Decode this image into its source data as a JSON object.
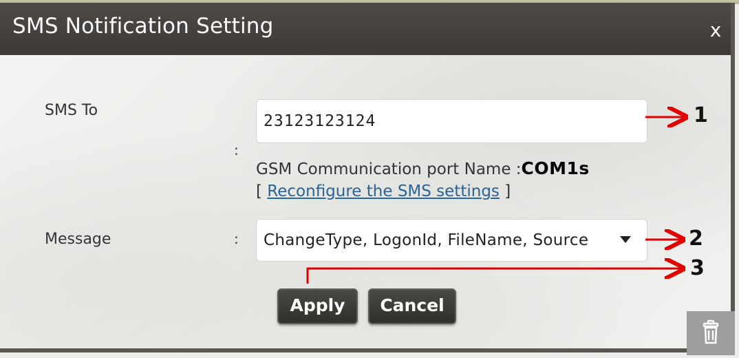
{
  "dialog": {
    "title": "SMS Notification Setting",
    "close_label": "x"
  },
  "form": {
    "sms_to": {
      "label": "SMS To",
      "separator": ":",
      "value": "23123123124"
    },
    "gsm": {
      "prefix": "GSM Communication port Name :",
      "port_name": "COM1s"
    },
    "reconfigure": {
      "open_bracket": "[ ",
      "link_text": "Reconfigure the SMS settings",
      "close_bracket": " ]"
    },
    "message": {
      "label": "Message",
      "separator": ":",
      "selected_value": "ChangeType, LogonId, FileName, Source"
    }
  },
  "buttons": {
    "apply_label": "Apply",
    "cancel_label": "Cancel"
  },
  "footer": {
    "trash_icon": "trash-icon"
  },
  "annotations": {
    "callouts": [
      "1",
      "2",
      "3"
    ],
    "arrow_color": "#e00000"
  },
  "colors": {
    "titlebar": "#45413d",
    "button": "#3a3b35",
    "link": "#2a6496"
  }
}
